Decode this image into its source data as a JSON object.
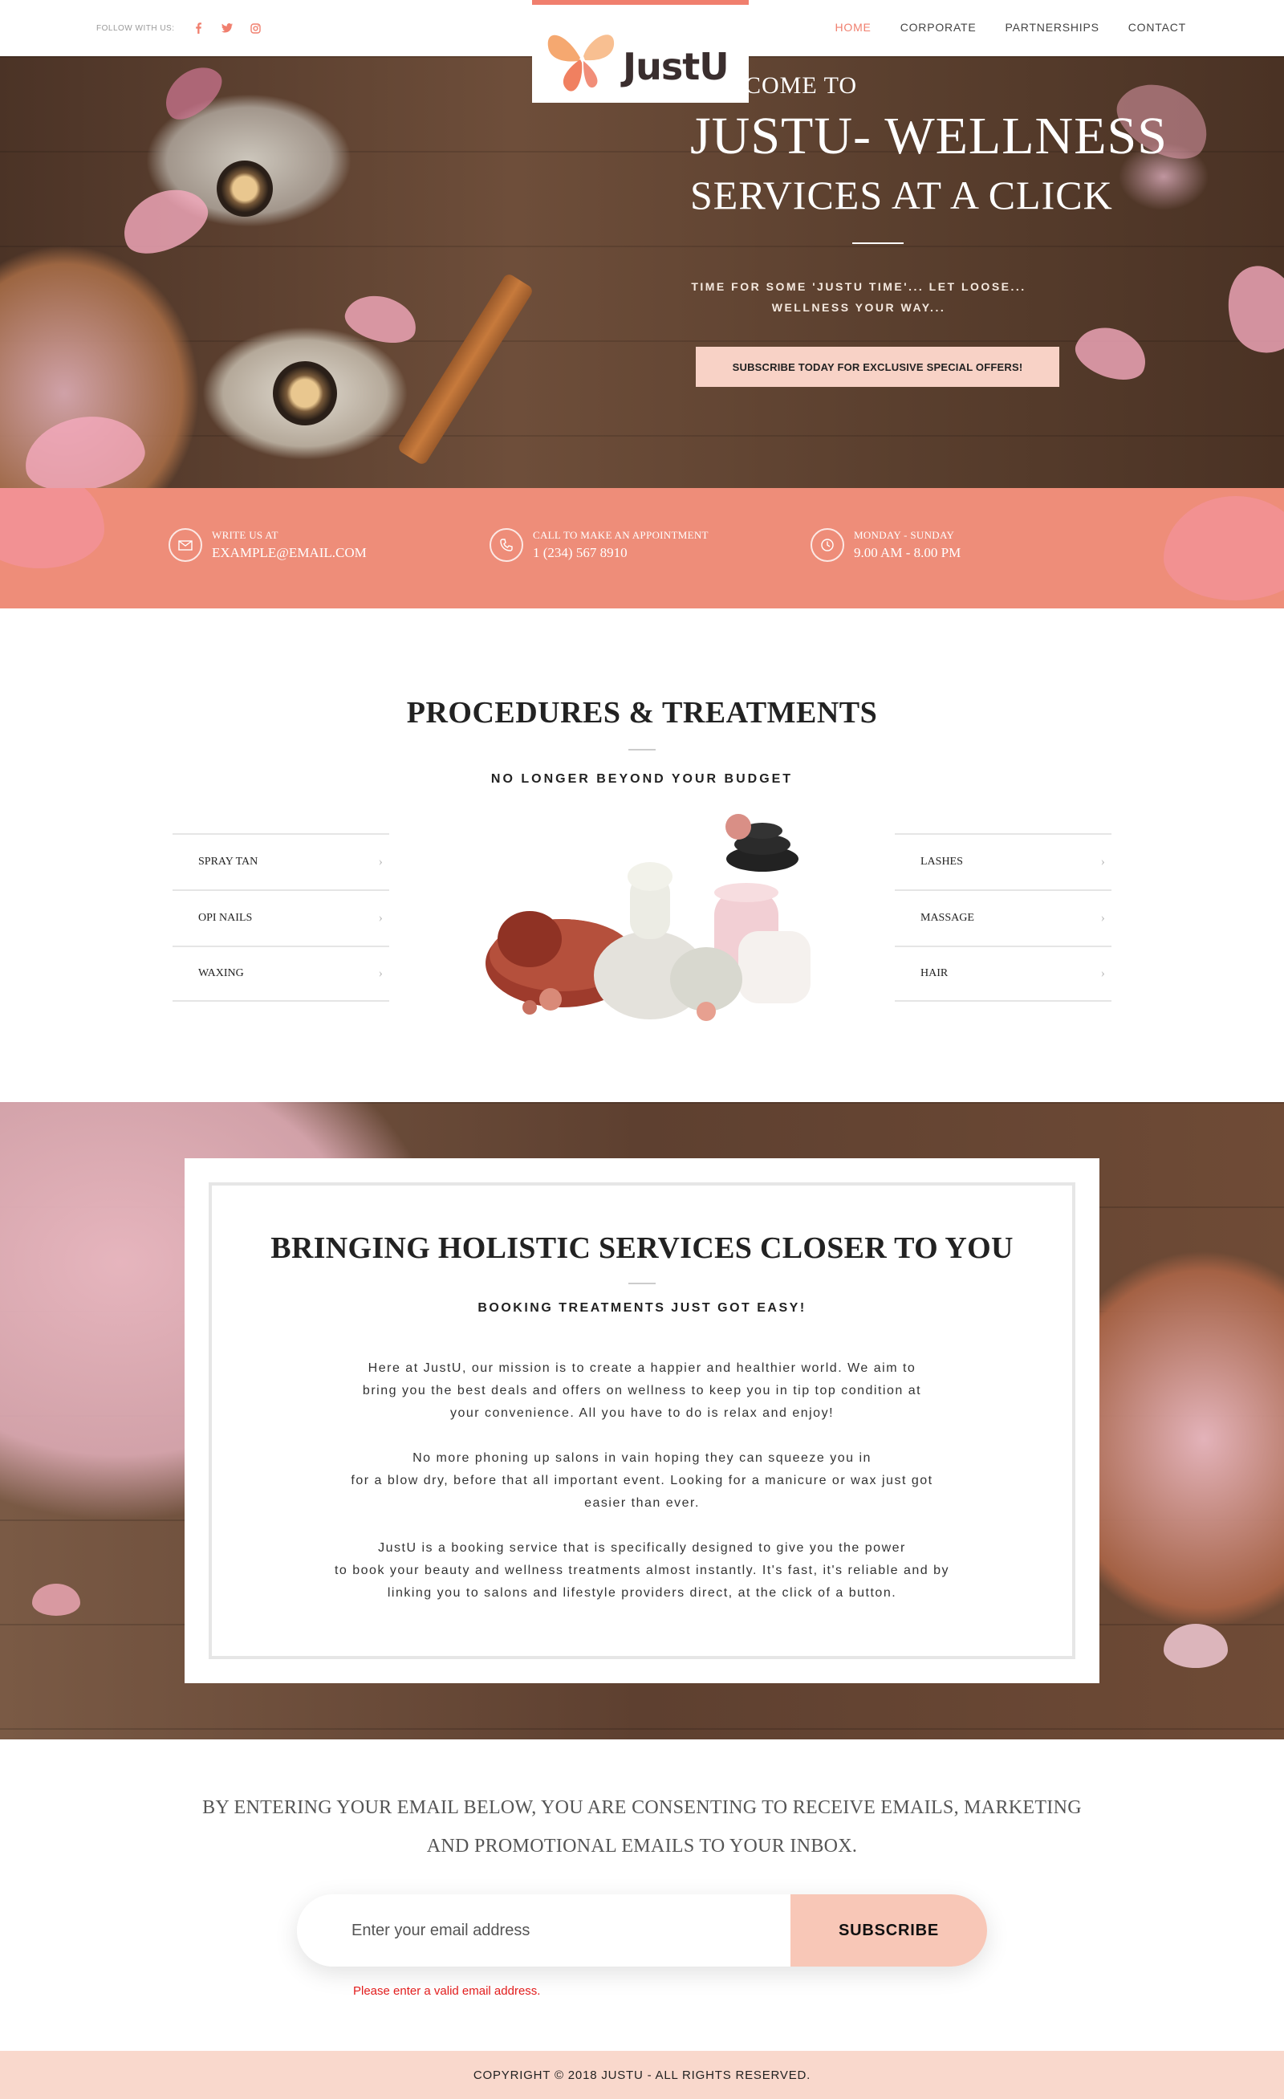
{
  "header": {
    "follow_label": "FOLLOW WITH US:",
    "social": [
      "facebook-icon",
      "twitter-icon",
      "instagram-icon"
    ],
    "nav": [
      {
        "label": "HOME",
        "active": true
      },
      {
        "label": "CORPORATE",
        "active": false
      },
      {
        "label": "PARTNERSHIPS",
        "active": false
      },
      {
        "label": "CONTACT",
        "active": false
      }
    ],
    "logo_text": "JustU"
  },
  "hero": {
    "welcome": "WELCOME TO",
    "title_line1": "JUSTU- WELLNESS",
    "title_line2": "SERVICES AT A CLICK",
    "tagline_line1": "TIME FOR SOME 'JUSTU TIME'... LET LOOSE...",
    "tagline_line2": "WELLNESS YOUR WAY...",
    "cta": "SUBSCRIBE TODAY FOR EXCLUSIVE SPECIAL OFFERS!"
  },
  "info": [
    {
      "icon": "envelope-icon",
      "label": "WRITE US AT",
      "value": "EXAMPLE@EMAIL.COM"
    },
    {
      "icon": "phone-icon",
      "label": "CALL TO MAKE AN APPOINTMENT",
      "value": "1 (234) 567 8910"
    },
    {
      "icon": "clock-icon",
      "label": "MONDAY - SUNDAY",
      "value": "9.00 AM - 8.00 PM"
    }
  ],
  "procedures": {
    "title": "PROCEDURES & TREATMENTS",
    "subtitle": "NO LONGER BEYOND YOUR BUDGET",
    "left": [
      "SPRAY TAN",
      "OPI NAILS",
      "WAXING"
    ],
    "right": [
      "LASHES",
      "MASSAGE",
      "HAIR"
    ]
  },
  "holistic": {
    "title": "BRINGING HOLISTIC SERVICES CLOSER TO YOU",
    "subtitle": "BOOKING TREATMENTS JUST GOT EASY!",
    "paragraphs": [
      [
        "Here at JustU, our mission is to create a happier and healthier world. We aim to",
        "bring you the best deals and offers on wellness to keep you in tip top condition at",
        "your convenience.  All you have to do is relax and enjoy!"
      ],
      [
        "No more phoning up salons in vain hoping they can squeeze you in",
        "for a blow dry, before that all important event. Looking for a manicure or wax just got",
        "easier than ever."
      ],
      [
        "JustU is a booking service that is specifically designed to give you the power",
        "to book your beauty and wellness treatments almost instantly. It's fast, it's reliable and by",
        "linking you to salons and lifestyle providers direct, at the click of a button."
      ]
    ]
  },
  "newsletter": {
    "consent_line1": "BY ENTERING YOUR EMAIL BELOW, YOU ARE CONSENTING TO RECEIVE EMAILS, MARKETING",
    "consent_line2": "AND PROMOTIONAL EMAILS TO YOUR INBOX.",
    "placeholder": "Enter your email address",
    "button": "SUBSCRIBE",
    "error": "Please enter a valid email address."
  },
  "footer": {
    "copyright": "COPYRIGHT © 2018 JUSTU - ALL RIGHTS RESERVED."
  },
  "colors": {
    "accent": "#f07f6e",
    "band": "#ee8d79",
    "soft_pink": "#f8d2c6",
    "footer": "#f9d8cc",
    "error": "#e21d1d"
  }
}
